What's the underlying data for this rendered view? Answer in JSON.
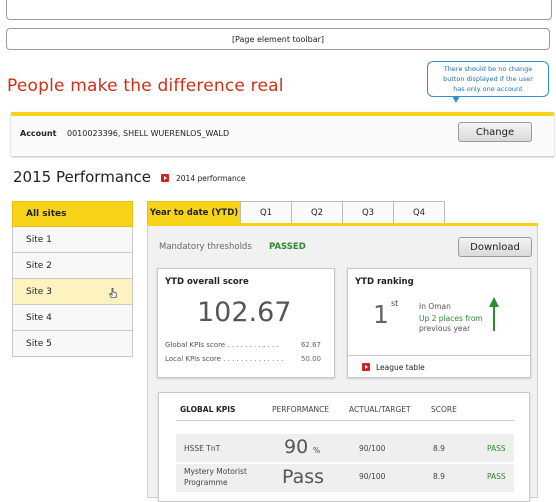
{
  "toolbar": {
    "label": "[Page element toolbar]"
  },
  "headline": "People make the difference real",
  "callout": {
    "line1": "There should be no change",
    "line2": "button displayed if the user",
    "line3": "has only one account"
  },
  "account": {
    "label": "Account",
    "value": "0010023396, SHELL WUERENLOS_WALD",
    "change_button": "Change"
  },
  "performance": {
    "title": "2015 Performance",
    "prev_link": "2014 performance"
  },
  "sites": [
    "All sites",
    "Site 1",
    "Site 2",
    "Site 3",
    "Site 4",
    "Site 5"
  ],
  "tabs": [
    "Year to date (YTD)",
    "Q1",
    "Q2",
    "Q3",
    "Q4"
  ],
  "mandatory": {
    "label": "Mandatory thresholds",
    "value": "PASSED"
  },
  "download_button": "Download",
  "ytd_score": {
    "title": "YTD overall score",
    "score": "102.67",
    "global_label": "Global KPIs score",
    "global_value": "62.67",
    "local_label": "Local KPIs score",
    "local_value": "50.00"
  },
  "ytd_ranking": {
    "title": "YTD ranking",
    "rank": "1",
    "suffix": "st",
    "region": "In Oman",
    "change_line1": "Up 2 places from",
    "change_line2": "previous year",
    "league_link": "League table"
  },
  "kpi_table": {
    "headers": [
      "GLOBAL KPIS",
      "PERFORMANCE",
      "ACTUAL/TARGET",
      "SCORE"
    ],
    "rows": [
      {
        "name1": "HSSE TnT",
        "name2": "",
        "perf": "90",
        "unit": "%",
        "actual": "90/100",
        "score": "8.9",
        "result": "PASS"
      },
      {
        "name1": "Mystery Motorist",
        "name2": "Programme",
        "perf": "Pass",
        "unit": "",
        "actual": "90/100",
        "score": "8.9",
        "result": "PASS"
      }
    ]
  },
  "colors": {
    "accent": "#f7d31a",
    "headline": "#cf2f16",
    "pass": "#2e8b2e",
    "callout": "#2f8fd8",
    "link_icon": "#d32020"
  }
}
